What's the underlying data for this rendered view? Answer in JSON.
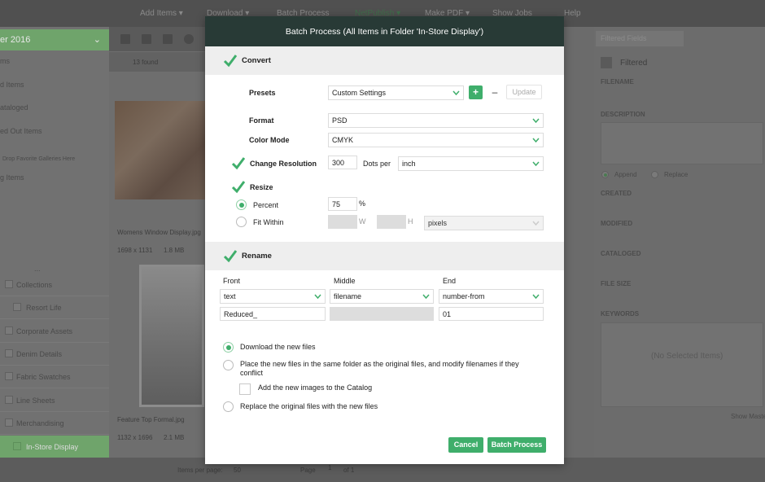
{
  "app": {
    "nav": [
      "Add Items ▾",
      "Download ▾",
      "Batch Process",
      "NetPublish ▾",
      "Make PDF ▾",
      "Show Jobs",
      "Help"
    ],
    "folder_title": "er 2016",
    "left_items": [
      "ms",
      "d Items",
      "ataloged",
      "ed Out Items",
      "Drop Favorite Galleries Here",
      "g Items"
    ],
    "tree_items": [
      "Collections",
      "Resort Life",
      "Corporate Assets",
      "Denim Details",
      "Fabric Swatches",
      "Line Sheets",
      "Merchandising",
      "In-Store Display"
    ],
    "found_count": "13 found",
    "thumbs": [
      {
        "name": "Womens Window Display.jpg",
        "dims": "1698 x 1131",
        "size": "1.8 MB"
      },
      {
        "name": "Feature Top Formal.jpg",
        "dims": "1132 x 1696",
        "size": "2.1 MB"
      }
    ],
    "right": {
      "field_select": "Filtered Fields",
      "filter_label": "Filtered",
      "labels": [
        "FILENAME",
        "DESCRIPTION",
        "CREATED",
        "MODIFIED",
        "CATALOGED",
        "FILE SIZE",
        "KEYWORDS"
      ],
      "append": "Append",
      "replace": "Replace",
      "no_selection": "(No Selected Items)",
      "show_master": "Show Maste"
    },
    "status": {
      "items_per_page_label": "Items per page:",
      "items_per_page": "50",
      "page_label": "Page",
      "page": "1",
      "of": "of 1"
    }
  },
  "modal": {
    "title": "Batch Process (All Items in Folder 'In-Store Display')",
    "convert": {
      "label": "Convert",
      "checked": true,
      "presets_label": "Presets",
      "presets_value": "Custom Settings",
      "update_label": "Update",
      "format_label": "Format",
      "format_value": "PSD",
      "color_mode_label": "Color Mode",
      "color_mode_value": "CMYK",
      "change_resolution_label": "Change Resolution",
      "resolution_value": "300",
      "dots_per_label": "Dots per",
      "dots_unit": "inch",
      "resize_label": "Resize",
      "percent_label": "Percent",
      "percent_value": "75",
      "percent_sign": "%",
      "fit_within_label": "Fit Within",
      "w_label": "W",
      "h_label": "H",
      "fit_unit": "pixels"
    },
    "rename": {
      "label": "Rename",
      "checked": true,
      "front_label": "Front",
      "middle_label": "Middle",
      "end_label": "End",
      "front_select": "text",
      "middle_select": "filename",
      "end_select": "number-from",
      "front_value": "Reduced_",
      "end_value": "01"
    },
    "output": {
      "download": "Download the new files",
      "place": "Place the new files in the same folder as the original files, and modify filenames if they",
      "place_cont": "conflict",
      "add_catalog": "Add the new images to the Catalog",
      "replace": "Replace the original files with the new files"
    },
    "cancel_label": "Cancel",
    "submit_label": "Batch Process"
  },
  "colors": {
    "accent": "#3fae6b",
    "modal_header": "#283a36"
  }
}
